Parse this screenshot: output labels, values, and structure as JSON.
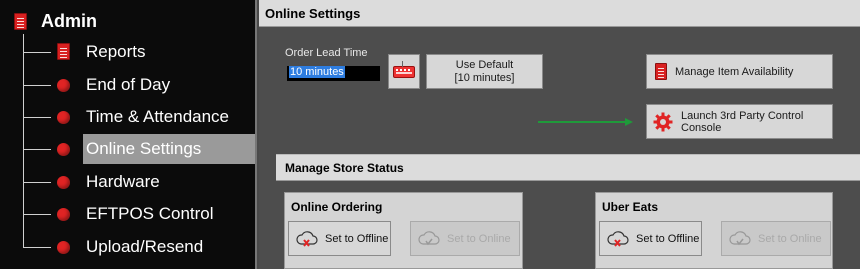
{
  "sidebar": {
    "title": "Admin",
    "items": [
      {
        "label": "Reports",
        "icon": "document-icon"
      },
      {
        "label": "End of Day",
        "icon": "red-dot-icon"
      },
      {
        "label": "Time & Attendance",
        "icon": "red-dot-icon"
      },
      {
        "label": "Online Settings",
        "icon": "red-dot-icon",
        "active": true
      },
      {
        "label": "Hardware",
        "icon": "red-dot-icon"
      },
      {
        "label": "EFTPOS Control",
        "icon": "red-dot-icon"
      },
      {
        "label": "Upload/Resend",
        "icon": "red-dot-icon"
      }
    ]
  },
  "main": {
    "header": "Online Settings",
    "lead_time": {
      "label": "Order Lead Time",
      "value": "10 minutes"
    },
    "use_default": {
      "line1": "Use Default",
      "line2": "[10 minutes]"
    },
    "manage_item_availability": "Manage Item Availability",
    "launch_console": {
      "line1": "Launch 3rd Party Control",
      "line2": "Console"
    },
    "store_status": {
      "header": "Manage Store Status",
      "groups": [
        {
          "title": "Online Ordering",
          "offline_label": "Set to Offline",
          "online_label": "Set to Online"
        },
        {
          "title": "Uber Eats",
          "offline_label": "Set to Offline",
          "online_label": "Set to Online"
        }
      ]
    }
  },
  "colors": {
    "accent_red": "#e02424",
    "arrow_green": "#1f9a3a",
    "active_item_bg": "#9a9a9a",
    "selection_blue": "#2e7de0"
  }
}
